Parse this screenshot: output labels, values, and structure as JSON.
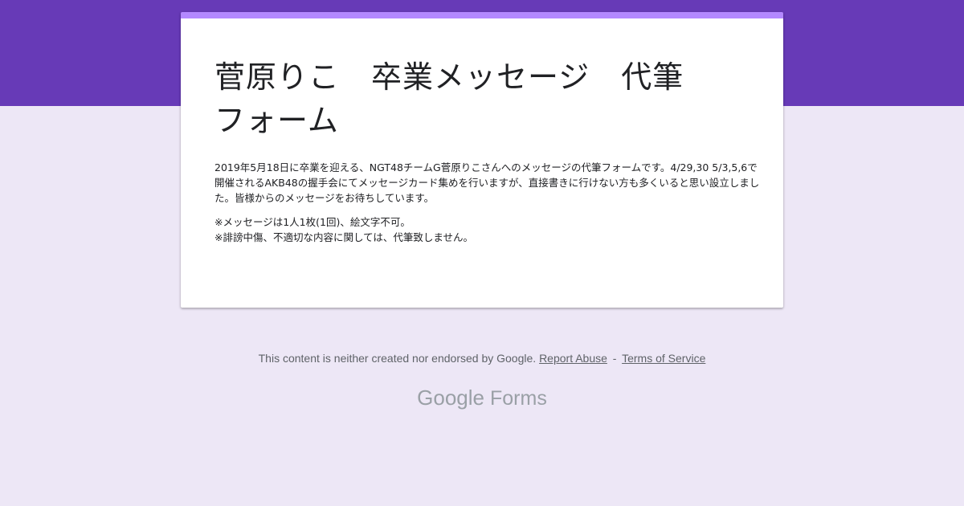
{
  "form": {
    "title": "菅原りこ　卒業メッセージ　代筆\nフォーム",
    "description": [
      "2019年5月18日に卒業を迎える、NGT48チームG菅原りこさんへのメッセージの代筆フォームです。4/29,30 5/3,5,6で開催されるAKB48の握手会にてメッセージカード集めを行いますが、直接書きに行けない方も多くいると思い設立しました。皆様からのメッセージをお待ちしています。",
      "※メッセージは1人1枚(1回)、絵文字不可。",
      "※誹謗中傷、不適切な内容に関しては、代筆致しません。"
    ]
  },
  "footer": {
    "disclaimer": "This content is neither created nor endorsed by Google.",
    "report_abuse": "Report Abuse",
    "separator": "-",
    "terms": "Terms of Service"
  },
  "brand": {
    "google": "Google",
    "forms": "Forms"
  },
  "colors": {
    "header_band": "#673ab7",
    "card_accent": "#b388ff",
    "page_background": "#ede7f6"
  }
}
